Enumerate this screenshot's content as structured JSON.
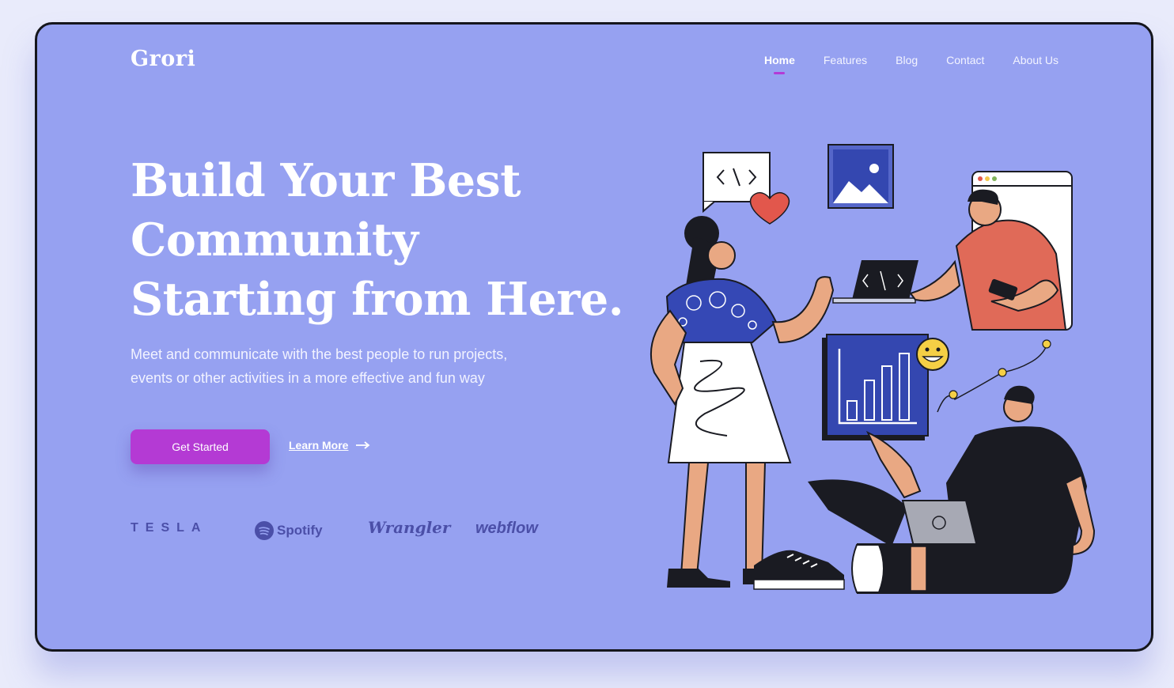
{
  "logo": "Grori",
  "nav": {
    "items": [
      "Home",
      "Features",
      "Blog",
      "Contact",
      "About Us"
    ],
    "active": "Home"
  },
  "hero": {
    "headline": [
      "Build Your Best",
      "Community",
      "Starting from Here."
    ],
    "subtext": "Meet and communicate with the best people to run projects, events or other activities in a more effective and fun way",
    "cta_primary": "Get Started",
    "cta_secondary": "Learn More"
  },
  "brands": [
    "TESLA",
    "Spotify",
    "Wrangler",
    "webflow"
  ],
  "colors": {
    "background": "#96a1f1",
    "accent": "#b43ad4",
    "text": "#ffffff",
    "brand_logos": "#4b4fa8"
  },
  "icons": [
    "arrow-right-icon",
    "spotify-icon",
    "code-icon",
    "heart-icon",
    "image-icon",
    "smiley-icon"
  ]
}
